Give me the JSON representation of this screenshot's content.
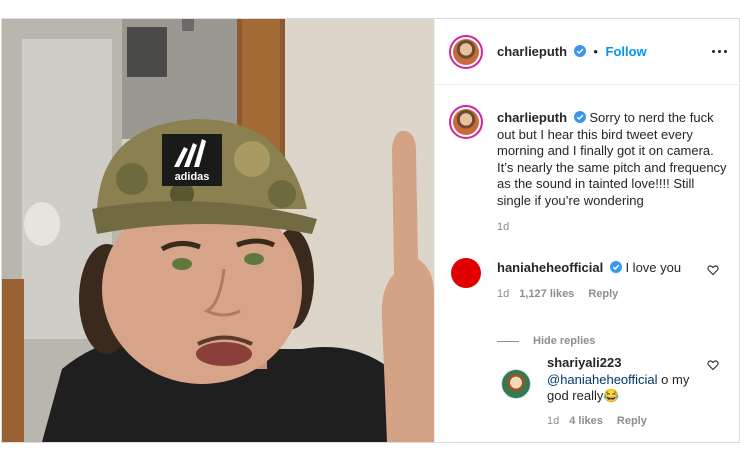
{
  "post": {
    "author": "charlieputh",
    "header_separator": "•",
    "follow_label": "Follow",
    "caption": "Sorry to nerd the fuck out but I hear this bird tweet every morning and I finally got it on camera. It’s nearly the same pitch and frequency as the sound in tainted love!!!! Still single if you’re wondering",
    "caption_age": "1d",
    "media_logo_text": "adidas"
  },
  "comments": [
    {
      "username": "haniaheheofficial",
      "text": "I love you",
      "age": "1d",
      "likes": "1,127 likes",
      "reply_label": "Reply",
      "avatar_color": "#e00000"
    }
  ],
  "thread": {
    "hide_replies_label": "Hide replies",
    "replies": [
      {
        "username": "shariyali223",
        "mention": "@haniaheheofficial",
        "text_line1": " o my",
        "text_line2": "god really😂",
        "age": "1d",
        "likes": "4 likes",
        "reply_label": "Reply"
      }
    ]
  },
  "colors": {
    "accent_blue": "#0095f6",
    "verified_blue": "#3897f0",
    "meta_gray": "#8e8e8e",
    "mention_blue": "#00376b"
  },
  "icons": [
    "verified-badge-icon",
    "more-options-icon",
    "heart-icon"
  ]
}
